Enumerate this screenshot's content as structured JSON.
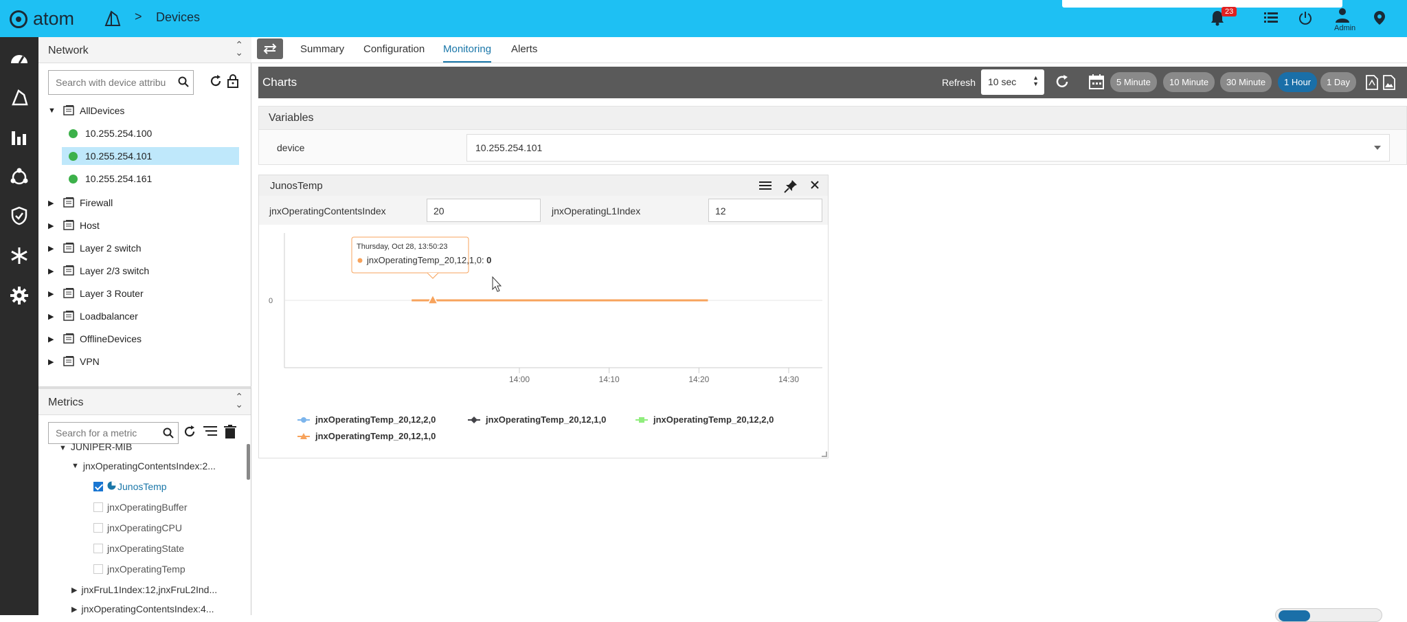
{
  "app": {
    "logo_text": "atom",
    "breadcrumb_sep": ">",
    "breadcrumb": "Devices"
  },
  "topbar": {
    "notification_count": "23",
    "admin_label": "Admin"
  },
  "network": {
    "title": "Network",
    "search_placeholder": "Search with device attributes",
    "root": "AllDevices",
    "devices": [
      "10.255.254.100",
      "10.255.254.101",
      "10.255.254.161"
    ],
    "selected_device": "10.255.254.101",
    "groups": [
      "Firewall",
      "Host",
      "Layer 2 switch",
      "Layer 2/3 switch",
      "Layer 3 Router",
      "Loadbalancer",
      "OfflineDevices",
      "VPN"
    ]
  },
  "metrics": {
    "title": "Metrics",
    "search_placeholder": "Search for a metric",
    "partial_top": "JUNIPER-MIB",
    "folder": "jnxOperatingContentsIndex:2...",
    "items": [
      {
        "label": "JunosTemp",
        "checked": true
      },
      {
        "label": "jnxOperatingBuffer",
        "checked": false
      },
      {
        "label": "jnxOperatingCPU",
        "checked": false
      },
      {
        "label": "jnxOperatingState",
        "checked": false
      },
      {
        "label": "jnxOperatingTemp",
        "checked": false
      }
    ],
    "folder2": "jnxFruL1Index:12,jnxFruL2Ind...",
    "folder3": "jnxOperatingContentsIndex:4..."
  },
  "tabs": [
    "Summary",
    "Configuration",
    "Monitoring",
    "Alerts"
  ],
  "active_tab": "Monitoring",
  "charts_bar": {
    "title": "Charts",
    "refresh_label": "Refresh",
    "refresh_value": "10 sec",
    "ranges": [
      "5 Minute",
      "10 Minute",
      "30 Minute",
      "1 Hour",
      "1 Day"
    ],
    "active_range": "1 Hour"
  },
  "variables": {
    "title": "Variables",
    "device_label": "device",
    "device_value": "10.255.254.101"
  },
  "chart_panel": {
    "title": "JunosTemp",
    "var1_label": "jnxOperatingContentsIndex",
    "var1_value": "20",
    "var2_label": "jnxOperatingL1Index",
    "var2_value": "12"
  },
  "chart_data": {
    "type": "line",
    "x_ticks": [
      "14:00",
      "14:10",
      "14:20",
      "14:30"
    ],
    "y_ticks": [
      "0"
    ],
    "ylim": [
      -1,
      1
    ],
    "series": [
      {
        "name": "jnxOperatingTemp_20,12,2,0",
        "color": "#7cb5ec",
        "marker": "circle"
      },
      {
        "name": "jnxOperatingTemp_20,12,1,0",
        "color": "#434348",
        "marker": "diamond"
      },
      {
        "name": "jnxOperatingTemp_20,12,2,0",
        "color": "#90ed7d",
        "marker": "square"
      },
      {
        "name": "jnxOperatingTemp_20,12,1,0",
        "color": "#f7a35c",
        "marker": "triangle",
        "x": [
          "13:48",
          "14:21"
        ],
        "y": [
          0,
          0
        ]
      }
    ],
    "tooltip": {
      "time": "Thursday, Oct 28, 13:50:23",
      "series": "jnxOperatingTemp_20,12,1,0:",
      "value": "0"
    }
  }
}
